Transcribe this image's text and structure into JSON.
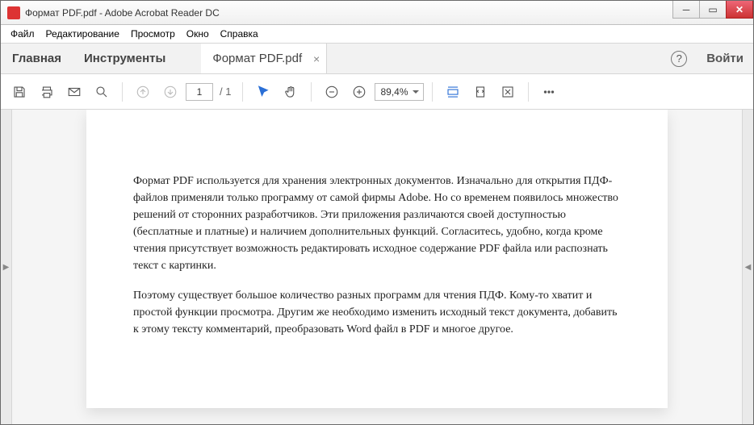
{
  "window": {
    "title": "Формат PDF.pdf - Adobe Acrobat Reader DC"
  },
  "menu": {
    "file": "Файл",
    "edit": "Редактирование",
    "view": "Просмотр",
    "window": "Окно",
    "help": "Справка"
  },
  "topnav": {
    "home": "Главная",
    "tools": "Инструменты",
    "filename": "Формат PDF.pdf",
    "login": "Войти"
  },
  "toolbar": {
    "page_current": "1",
    "page_total": "/ 1",
    "zoom": "89,4%"
  },
  "document": {
    "p1": "Формат PDF используется для хранения электронных документов. Изначально для открытия ПДФ-файлов применяли только программу от самой фирмы Adobe. Но со временем появилось множество решений от сторонних разработчиков. Эти приложения различаются своей доступностью (бесплатные и платные) и наличием дополнительных функций. Согласитесь, удобно, когда кроме чтения присутствует возможность редактировать исходное содержание PDF файла или распознать текст с картинки.",
    "p2": "Поэтому существует большое количество разных программ для чтения ПДФ. Кому-то хватит и простой функции просмотра. Другим же необходимо изменить исходный текст документа, добавить к этому тексту комментарий, преобразовать Word файл в PDF и многое другое."
  }
}
